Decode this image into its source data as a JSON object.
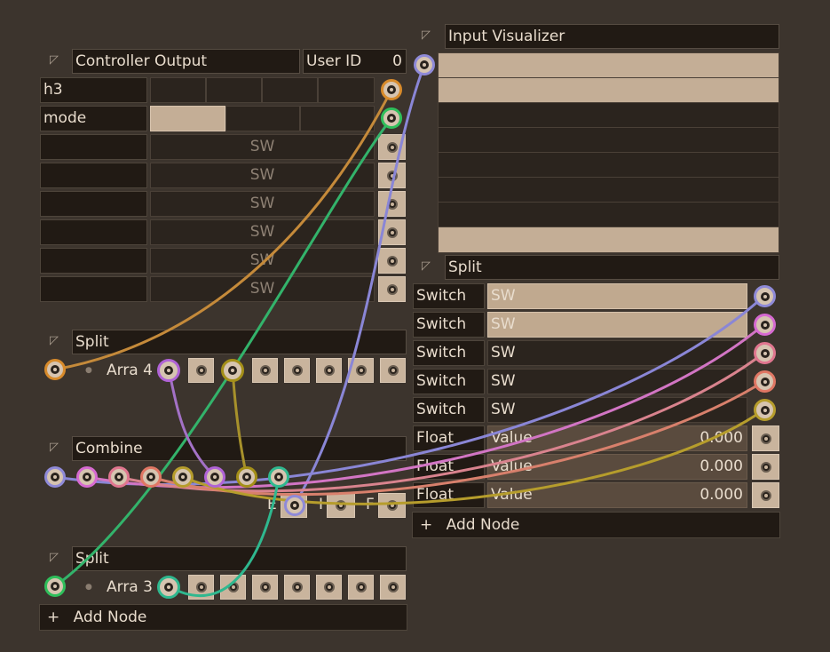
{
  "controller_output": {
    "title": "Controller Output",
    "user_id_label": "User ID",
    "user_id_value": "0",
    "rows": [
      {
        "label": "h3"
      },
      {
        "label": "mode"
      },
      {
        "label": "",
        "value": "SW"
      },
      {
        "label": "",
        "value": "SW"
      },
      {
        "label": "",
        "value": "SW"
      },
      {
        "label": "",
        "value": "SW"
      },
      {
        "label": "",
        "value": "SW"
      },
      {
        "label": "",
        "value": "SW"
      }
    ]
  },
  "split_a": {
    "title": "Split",
    "array_label": "Arra 4"
  },
  "combine": {
    "title": "Combine",
    "port_labels": [
      "E",
      "I",
      "F"
    ]
  },
  "split_b": {
    "title": "Split",
    "array_label": "Arra 3"
  },
  "add_node_left": {
    "icon": "+",
    "label": "Add Node"
  },
  "input_visualizer": {
    "title": "Input Visualizer",
    "rows_on": [
      true,
      true,
      false,
      false,
      false,
      false,
      false,
      true
    ]
  },
  "split_c": {
    "title": "Split",
    "rows": [
      {
        "type": "Switch",
        "value": "SW",
        "active": true
      },
      {
        "type": "Switch",
        "value": "SW",
        "active": true
      },
      {
        "type": "Switch",
        "value": "SW",
        "active": false
      },
      {
        "type": "Switch",
        "value": "SW",
        "active": false
      },
      {
        "type": "Switch",
        "value": "SW",
        "active": false
      },
      {
        "type": "Float",
        "value": "Value",
        "number": "0.000"
      },
      {
        "type": "Float",
        "value": "Value",
        "number": "0.000"
      },
      {
        "type": "Float",
        "value": "Value",
        "number": "0.000"
      }
    ]
  },
  "add_node_right": {
    "icon": "+",
    "label": "Add Node"
  },
  "colors": {
    "background": "#3c342d",
    "wire_orange": "#c58a3a",
    "wire_green": "#33b36b",
    "wire_blue": "#8a86d6",
    "wire_pink": "#d275c4",
    "wire_rose": "#d9838e",
    "wire_salmon": "#d8806c",
    "wire_olive": "#b69d2c",
    "wire_teal": "#2fb88f"
  }
}
